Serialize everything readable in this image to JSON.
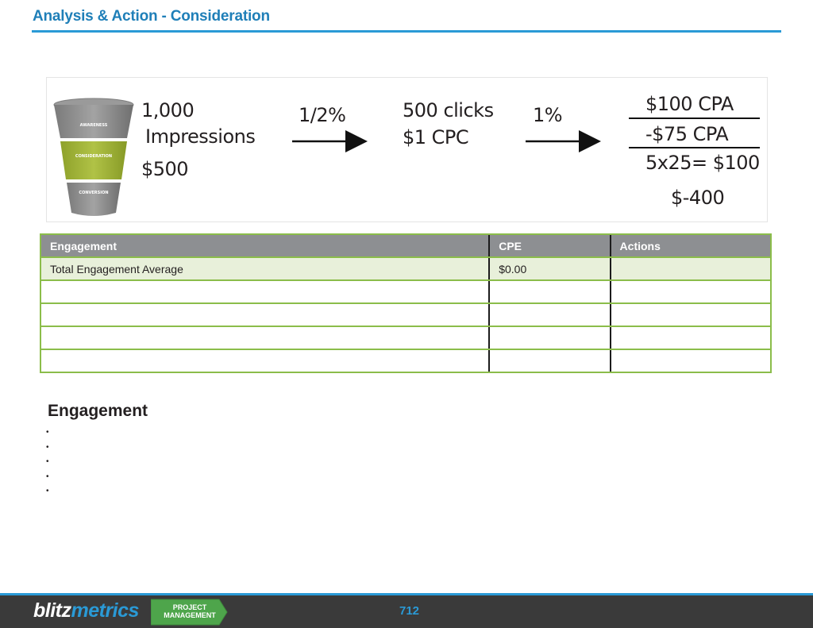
{
  "title": "Analysis & Action - Consideration",
  "funnel": {
    "stage_labels": [
      "AWARENESS",
      "CONSIDERATION",
      "CONVERSION"
    ],
    "impressions_count": "1,000",
    "impressions_label": "Impressions",
    "impressions_cost": "$500",
    "ctr": "1/2%",
    "clicks": "500 clicks",
    "cpc": "$1 CPC",
    "conversion_rate": "1%",
    "cpa_top": "$100 CPA",
    "cpa_minus": "-$75 CPA",
    "calc": "5x25= $100",
    "result": "$-400"
  },
  "table": {
    "headers": [
      "Engagement",
      "CPE",
      "Actions"
    ],
    "rows": [
      [
        "Total Engagement Average",
        "$0.00",
        ""
      ],
      [
        "",
        "",
        ""
      ],
      [
        "",
        "",
        ""
      ],
      [
        "",
        "",
        ""
      ],
      [
        "",
        "",
        ""
      ]
    ]
  },
  "section_heading": "Engagement",
  "bullets": [
    "",
    "",
    "",
    "",
    ""
  ],
  "footer": {
    "logo_part1": "blitz",
    "logo_part2": "metrics",
    "tag_line1": "PROJECT",
    "tag_line2": "MANAGEMENT",
    "page_number": "712"
  },
  "colors": {
    "title_blue": "#1f7fb8",
    "accent_blue": "#2a9ad6",
    "table_border_green": "#8bbd4a",
    "header_gray": "#8d8f92",
    "highlight_row": "#e8f0da",
    "funnel_green": "#9bb035",
    "funnel_gray": "#8a8a8a",
    "footer_dark": "#3a3a3a",
    "tag_green": "#4ea54b"
  }
}
